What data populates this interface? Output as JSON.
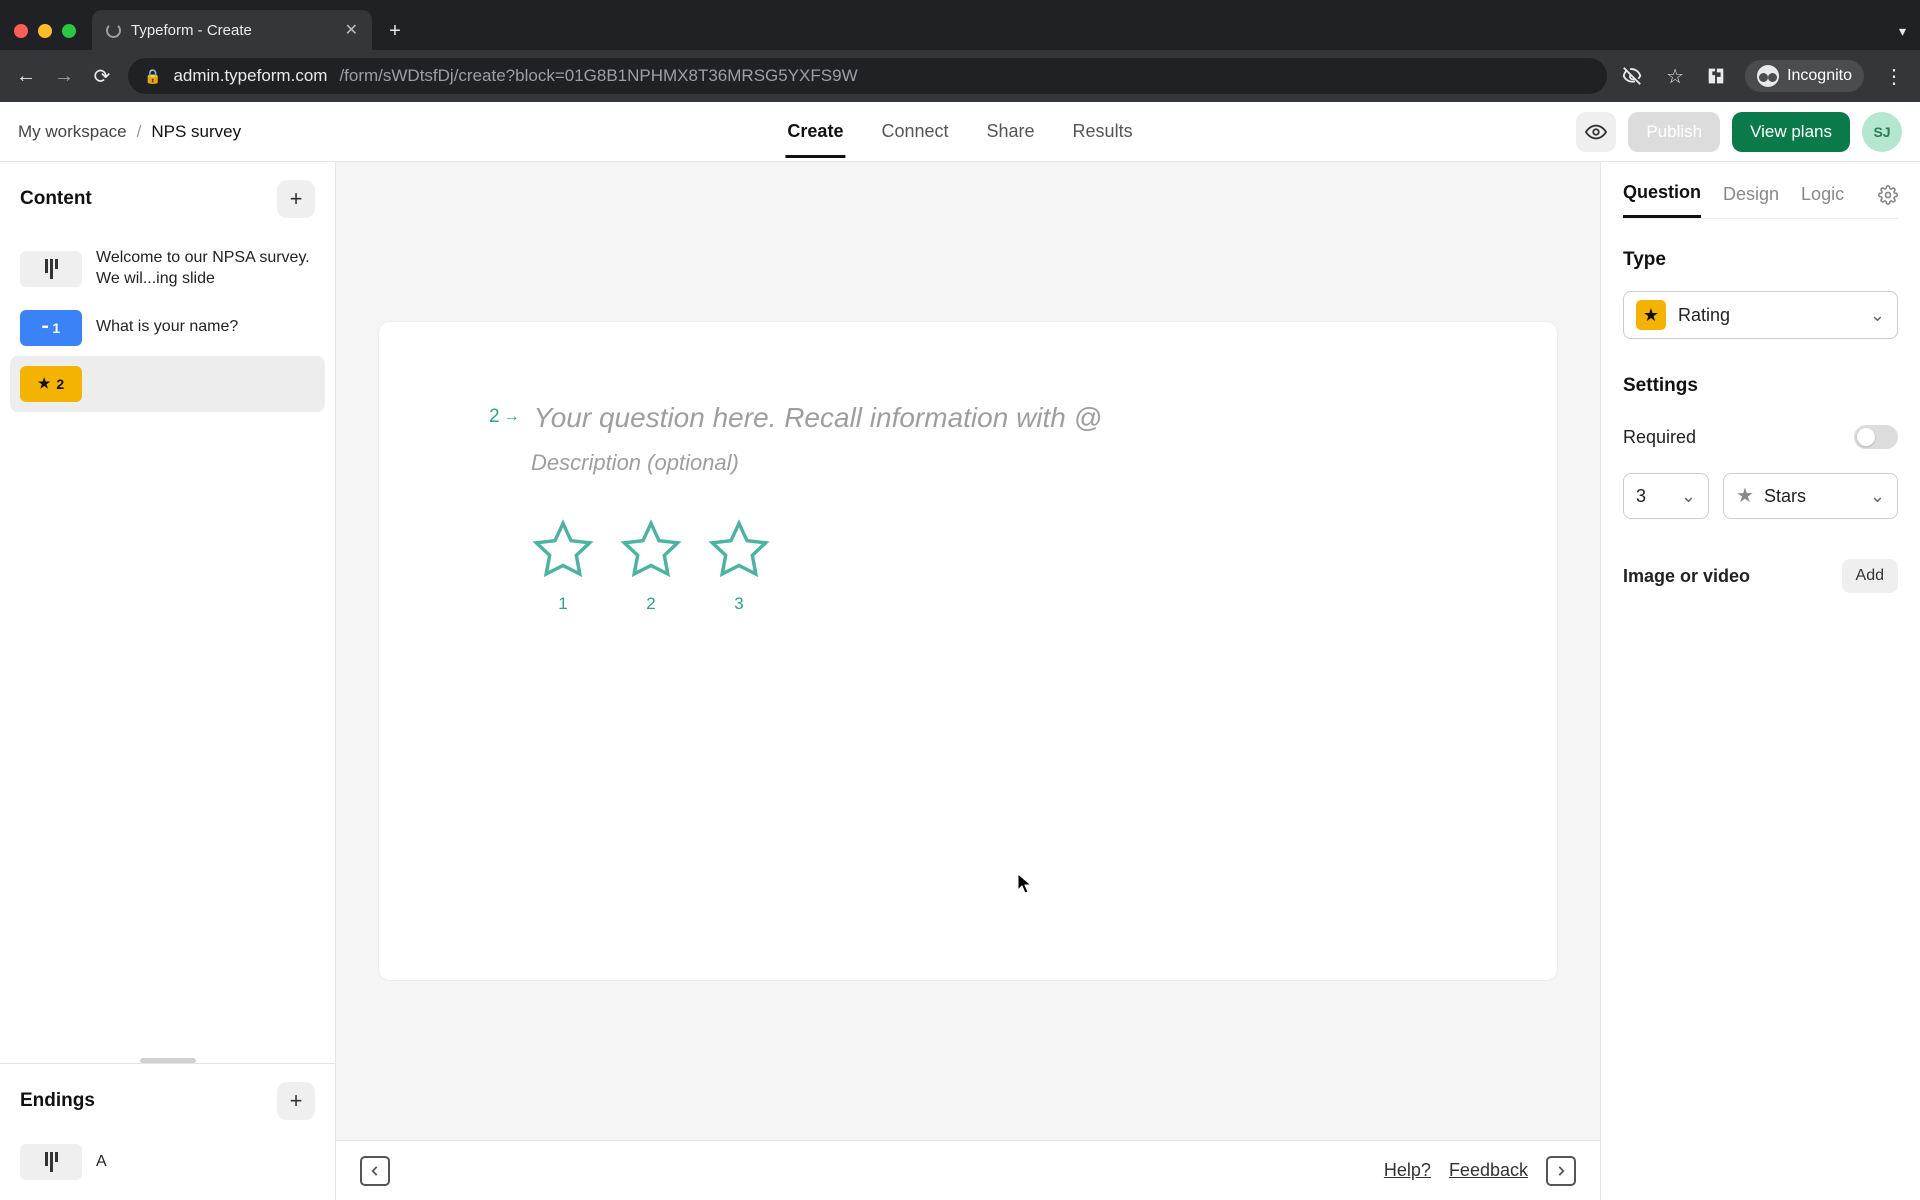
{
  "browser": {
    "tab_title": "Typeform - Create",
    "url_host": "admin.typeform.com",
    "url_path": "/form/sWDtsfDj/create?block=01G8B1NPHMX8T36MRSG5YXFS9W",
    "incognito_label": "Incognito"
  },
  "topbar": {
    "workspace": "My workspace",
    "separator": "/",
    "form_title": "NPS survey",
    "tabs": [
      "Create",
      "Connect",
      "Share",
      "Results"
    ],
    "active_tab": "Create",
    "publish_label": "Publish",
    "view_plans_label": "View plans",
    "avatar_initials": "SJ"
  },
  "sidebar": {
    "content_title": "Content",
    "items": [
      {
        "kind": "welcome",
        "text": "Welcome to our NPSA survey. We wil...ing slide"
      },
      {
        "kind": "short_text",
        "num": "1",
        "text": "What is your name?"
      },
      {
        "kind": "rating",
        "num": "2",
        "text": ""
      }
    ],
    "endings_title": "Endings",
    "endings": [
      {
        "label": "A"
      }
    ]
  },
  "canvas": {
    "question_number": "2",
    "question_placeholder": "Your question here. Recall information with @",
    "description_placeholder": "Description (optional)",
    "star_labels": [
      "1",
      "2",
      "3"
    ]
  },
  "footer": {
    "help": "Help?",
    "feedback": "Feedback"
  },
  "rightpanel": {
    "tabs": [
      "Question",
      "Design",
      "Logic"
    ],
    "active_tab": "Question",
    "type_label": "Type",
    "type_value": "Rating",
    "settings_label": "Settings",
    "required_label": "Required",
    "count_value": "3",
    "shape_value": "Stars",
    "media_label": "Image or video",
    "add_label": "Add"
  }
}
